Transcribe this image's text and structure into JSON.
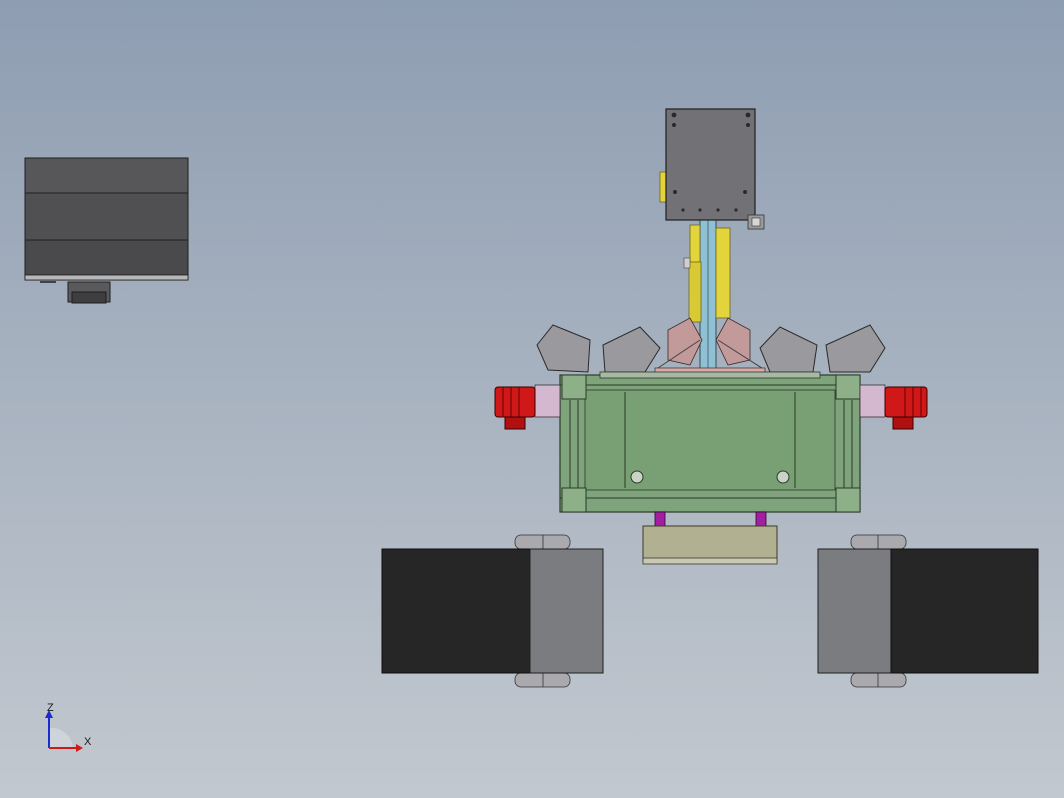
{
  "viewport": {
    "background_top": "#8e9db2",
    "background_bottom": "#c2c8cf"
  },
  "colors": {
    "frame_green": "#7fa37a",
    "motor_red": "#d01818",
    "robot_yellow": "#e2d43a",
    "track_dark": "#262626",
    "track_gray": "#7b7c80",
    "panel_gray": "#6f6f73",
    "tray_khaki": "#b1b090",
    "bracket_purple": "#a020a0"
  },
  "triad": {
    "z_label": "Z",
    "x_label": "X",
    "icon": "coordinate-triad-icon"
  }
}
